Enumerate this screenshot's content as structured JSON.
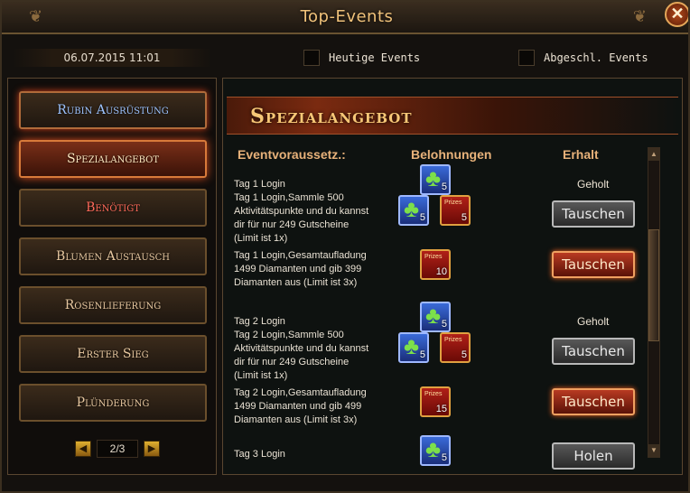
{
  "window": {
    "title": "Top-Events",
    "close_label": "✕"
  },
  "topbar": {
    "datetime": "06.07.2015 11:01",
    "today_events_label": "Heutige Events",
    "finished_events_label": "Abgeschl. Events"
  },
  "sidebar": {
    "items": [
      {
        "label": "Rubin Ausrüstung"
      },
      {
        "label": "Spezialangebot"
      },
      {
        "label": "Benötigt"
      },
      {
        "label": "Blumen Austausch"
      },
      {
        "label": "Rosenlieferung"
      },
      {
        "label": "Erster Sieg"
      },
      {
        "label": "Plünderung"
      }
    ],
    "pager": {
      "prev": "◀",
      "page": "2/3",
      "next": "▶"
    }
  },
  "main": {
    "banner": "Spezialangebot",
    "columns": {
      "requirement": "Eventvoraussetz.:",
      "rewards": "Belohnungen",
      "received": "Erhalt"
    },
    "rows": [
      {
        "desc": "Tag 1 Login",
        "rewards": [
          {
            "icon": "clover-icon",
            "count": "5"
          }
        ],
        "status": "Geholt"
      },
      {
        "desc": "Tag 1 Login,Sammle 500 Aktivitätspunkte und du kannst dir für nur 249 Gutscheine (Limit ist 1x)",
        "rewards": [
          {
            "icon": "clover-icon",
            "count": "5"
          },
          {
            "icon": "chest-icon",
            "count": "5"
          }
        ],
        "button": "Tauschen"
      },
      {
        "desc": "Tag 1 Login,Gesamtaufladung 1499 Diamanten und gib 399 Diamanten aus (Limit ist 3x)",
        "rewards": [
          {
            "icon": "chest-icon",
            "count": "10"
          }
        ],
        "button": "Tauschen"
      },
      {
        "desc": "Tag 2 Login",
        "rewards": [
          {
            "icon": "clover-icon",
            "count": "5"
          }
        ],
        "status": "Geholt"
      },
      {
        "desc": "Tag 2 Login,Sammle 500 Aktivitätspunkte und du kannst dir für nur 249 Gutscheine (Limit ist 1x)",
        "rewards": [
          {
            "icon": "clover-icon",
            "count": "5"
          },
          {
            "icon": "chest-icon",
            "count": "5"
          }
        ],
        "button": "Tauschen"
      },
      {
        "desc": "Tag 2 Login,Gesamtaufladung 1499 Diamanten und gib 499 Diamanten aus (Limit ist 3x)",
        "rewards": [
          {
            "icon": "chest-icon",
            "count": "15"
          }
        ],
        "button": "Tauschen"
      },
      {
        "desc": "Tag 3 Login",
        "rewards": [
          {
            "icon": "clover-icon",
            "count": "5"
          }
        ],
        "button": "Holen"
      }
    ]
  },
  "colors": {
    "accent": "#e05020",
    "title": "#f0c27a",
    "header": "#e8b27a"
  }
}
